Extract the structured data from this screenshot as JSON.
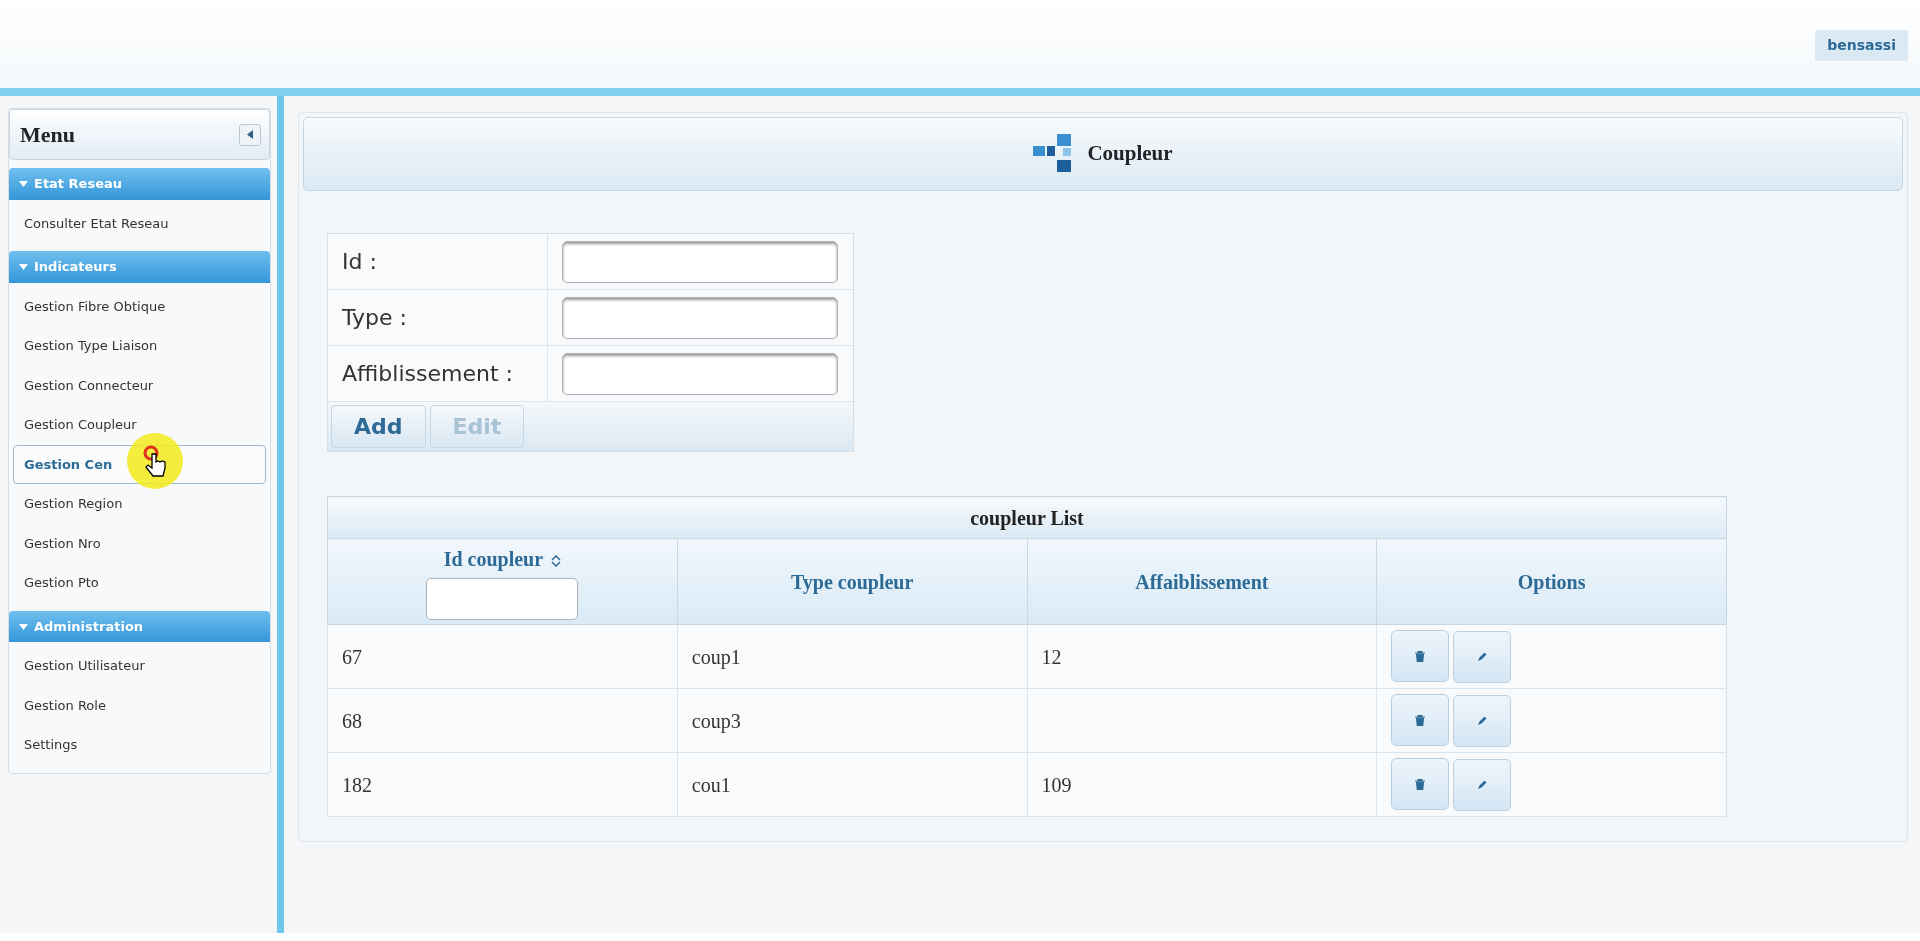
{
  "header": {
    "user": "bensassi"
  },
  "sidebar": {
    "title": "Menu",
    "sections": [
      {
        "title": "Etat Reseau",
        "expanded": true,
        "items": [
          {
            "label": "Consulter Etat Reseau",
            "hovered": false
          }
        ]
      },
      {
        "title": "Indicateurs",
        "expanded": true,
        "items": [
          {
            "label": "Gestion Fibre Obtique",
            "hovered": false
          },
          {
            "label": "Gestion Type Liaison",
            "hovered": false
          },
          {
            "label": "Gestion Connecteur",
            "hovered": false
          },
          {
            "label": "Gestion Coupleur",
            "hovered": false
          },
          {
            "label": "Gestion Cen",
            "hovered": true
          },
          {
            "label": "Gestion Region",
            "hovered": false
          },
          {
            "label": "Gestion Nro",
            "hovered": false
          },
          {
            "label": "Gestion Pto",
            "hovered": false
          }
        ]
      },
      {
        "title": "Administration",
        "expanded": true,
        "items": [
          {
            "label": "Gestion Utilisateur",
            "hovered": false
          },
          {
            "label": "Gestion Role",
            "hovered": false
          },
          {
            "label": "Settings",
            "hovered": false
          }
        ]
      }
    ]
  },
  "page": {
    "title": "Coupleur"
  },
  "form": {
    "fields": [
      {
        "label": "Id :"
      },
      {
        "label": "Type :"
      },
      {
        "label": "Affiblissement :"
      }
    ],
    "buttons": [
      {
        "label": "Add",
        "disabled": false
      },
      {
        "label": "Edit",
        "disabled": true
      }
    ]
  },
  "table": {
    "title": "coupleur List",
    "columns": [
      {
        "label": "Id coupleur",
        "sortable": true,
        "filter": true
      },
      {
        "label": "Type coupleur",
        "sortable": false,
        "filter": false
      },
      {
        "label": "Affaiblissement",
        "sortable": false,
        "filter": false
      },
      {
        "label": "Options",
        "sortable": false,
        "filter": false
      }
    ],
    "rows": [
      [
        "67",
        "coup1",
        "12"
      ],
      [
        "68",
        "coup3",
        ""
      ],
      [
        "182",
        "cou1",
        "109"
      ]
    ]
  }
}
